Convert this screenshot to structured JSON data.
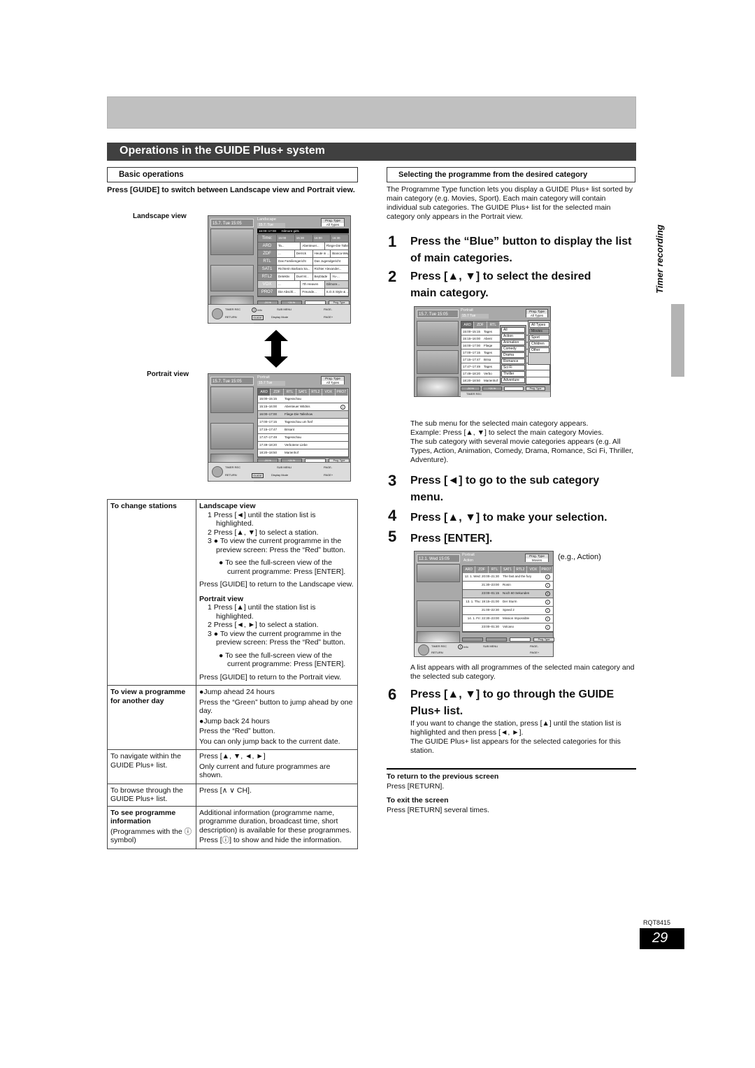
{
  "section_title": "Operations in the GUIDE Plus+ system",
  "basic_operations": {
    "heading": "Basic operations",
    "instruction": "Press [GUIDE] to switch between Landscape view and Portrait view.",
    "landscape_label": "Landscape view",
    "portrait_label": "Portrait view"
  },
  "landscape_screen": {
    "datetime": "15.7. Tue   15:05",
    "title": "Landscape",
    "subtitle": "15.7. Tue",
    "prog_type_label": "Prog. Type",
    "prog_type_value": "All Types",
    "now_playing": {
      "time": "16:00–17:00",
      "title": "Gilmore girls"
    },
    "time_header": [
      "Time:",
      "15:00",
      "15:30",
      "16:00",
      "16:30"
    ],
    "rows": [
      {
        "station": "ARD",
        "programmes": [
          "Ta...",
          "Abenteuer...",
          "Fliege-Die Talkshow"
        ]
      },
      {
        "station": "ZDF",
        "programmes": [
          "...",
          "Derrick",
          "Heute in ...",
          "Bianca-Wege..."
        ]
      },
      {
        "station": "RTL",
        "programmes": [
          "Das Familiengericht",
          "Das Jugendgericht"
        ]
      },
      {
        "station": "SAT1",
        "programmes": [
          "Richterin Barbara Sa...",
          "Richter Alexander..."
        ]
      },
      {
        "station": "RTL2",
        "programmes": [
          "Detektiv",
          "Duel M...",
          "Beyblade",
          "Yu-..."
        ]
      },
      {
        "station": "VOX",
        "programmes": [
          "...",
          "7th Heaven",
          "Gilmore..."
        ]
      },
      {
        "station": "PRO7",
        "programmes": [
          "Die Abschl...",
          "Freunde...",
          "S.O.S Style & ..."
        ]
      }
    ],
    "buttons": [
      "-24 Hr",
      "+24 Hr",
      "",
      "Prog. Type"
    ],
    "footer": {
      "timer_rec": "TIMER REC",
      "return": "RETURN",
      "info": "Info",
      "sub_menu": "SUB MENU",
      "guide": "GUIDE",
      "display_mode": "Display Mode",
      "page_minus": "PAGE-",
      "page_plus": "PAGE+"
    }
  },
  "portrait_screen": {
    "datetime": "15.7. Tue   15:05",
    "title": "Portrait",
    "subtitle": "15.7 Tue",
    "prog_type_label": "Prog. Type",
    "prog_type_value": "All Types",
    "stations": [
      "ARD",
      "ZDF",
      "RTL",
      "SAT1",
      "RTL2",
      "VOX",
      "PRO7"
    ],
    "rows": [
      {
        "time": "15:00–15:15",
        "title": "Tagesschau"
      },
      {
        "time": "15:15–16:00",
        "title": "Abenteuer Wildnis",
        "info": true
      },
      {
        "time": "16:00–17:00",
        "title": "Fliege-Die Talkshow",
        "highlight": true
      },
      {
        "time": "17:00–17:15",
        "title": "Tagesschau um fünf"
      },
      {
        "time": "17:15–17:47",
        "title": "Brisant"
      },
      {
        "time": "17:47–17:49",
        "title": "Tagesschau"
      },
      {
        "time": "17:49–18:20",
        "title": "Verbotene Liebe"
      },
      {
        "time": "18:20–18:50",
        "title": "Marienhof"
      }
    ],
    "buttons": [
      "-24 Hr",
      "+24 Hr",
      "",
      "Prog. Type"
    ],
    "footer": {
      "timer_rec": "TIMER REC",
      "return": "RETURN",
      "sub_menu": "SUB MENU",
      "guide": "GUIDE",
      "display_mode": "Display Mode",
      "page_minus": "PAGE-",
      "page_plus": "PAGE+"
    }
  },
  "ops_table": [
    {
      "label": "To change stations",
      "label_bold": true,
      "blocks": [
        {
          "heading": "Landscape view",
          "lines": [
            "1  Press [◄] until the station list is highlighted.",
            "2  Press [▲, ▼] to select a station.",
            "3  ● To view the current programme in the preview screen: Press the “Red” button.",
            "● To see the full-screen view of the current programme: Press [ENTER]."
          ],
          "after": "Press [GUIDE] to return to the Landscape view."
        },
        {
          "heading": "Portrait view",
          "lines": [
            "1  Press [▲] until the station list is highlighted.",
            "2  Press [◄, ►] to select a station.",
            "3  ● To view the current programme in the preview screen: Press the “Red” button.",
            "● To see the full-screen view of the current programme: Press [ENTER]."
          ],
          "after": "Press [GUIDE] to return to the Portrait view."
        }
      ]
    },
    {
      "label": "To view a programme for another day",
      "label_bold": true,
      "lines": [
        "●Jump ahead 24 hours",
        "Press the “Green” button to jump ahead by one day.",
        "●Jump back 24 hours",
        "Press the “Red” button.",
        "You can only jump back to the current date."
      ]
    },
    {
      "label": "To navigate within the GUIDE Plus+ list.",
      "label_bold": false,
      "lines": [
        "Press [▲, ▼, ◄, ►]",
        "Only current and future programmes are shown."
      ]
    },
    {
      "label": "To browse through the GUIDE Plus+ list.",
      "label_bold": false,
      "lines": [
        "Press [∧  ∨ CH]."
      ]
    },
    {
      "label": "To see programme information",
      "label_bold": true,
      "label_extra": "(Programmes with the ⓘ symbol)",
      "lines": [
        "Additional information (programme name, programme duration, broadcast time, short description) is available for these programmes.",
        "Press [ⓘ] to show and hide the information."
      ]
    }
  ],
  "category": {
    "heading": "Selecting the programme from the desired category",
    "intro": "The Programme Type function lets you display a GUIDE Plus+ list sorted by main category (e.g. Movies, Sport). Each main category will contain individual sub categories. The GUIDE Plus+ list for the selected main category only appears in the Portrait view.",
    "steps": [
      {
        "num": "1",
        "text": "Press the “Blue” button to display the list of main categories."
      },
      {
        "num": "2",
        "text": "Press [▲, ▼] to select the desired main category."
      },
      {
        "num": "3",
        "text": "Press [◄] to go to the sub category menu."
      },
      {
        "num": "4",
        "text": "Press [▲, ▼] to make your selection."
      },
      {
        "num": "5",
        "text": "Press [ENTER]."
      },
      {
        "num": "6",
        "text": "Press [▲, ▼] to go through the GUIDE Plus+ list."
      }
    ],
    "after_step2": "The sub menu for the selected main category appears.\nExample: Press [▲, ▼] to select the main category Movies.\nThe sub category with several movie categories appears (e.g. All Types, Action, Animation, Comedy, Drama, Romance, Sci Fi, Thriller, Adventure).",
    "example_caption": "(e.g., Action)",
    "after_step5": "A list appears with all programmes of the selected main category and the selected sub category.",
    "after_step6": "If you want to change the station, press [▲] until the station list is highlighted and then press [◄, ►].\nThe GUIDE Plus+ list appears for the selected categories for this station.",
    "return_heading": "To return to the previous screen",
    "return_text": "Press [RETURN].",
    "exit_heading": "To exit the screen",
    "exit_text": "Press [RETURN] several times."
  },
  "category_screen": {
    "datetime": "15.7. Tue   15:05",
    "title": "Portrait",
    "subtitle": "15.7 Tue",
    "prog_type_label": "Prog. Type",
    "prog_type_value": "All Types",
    "stations": [
      "ARD",
      "ZDF",
      "RTL"
    ],
    "times": [
      "15:00–15:15",
      "15:15–16:00",
      "16:00–17:00",
      "17:00–17:15",
      "17:15–17:47",
      "17:47–17:49",
      "17:49–18:20",
      "18:20–18:50"
    ],
    "titles": [
      "Tages",
      "Abent",
      "Fliege",
      "Tages",
      "Brisa",
      "Tages",
      "Verbo",
      "Marienhof"
    ],
    "sub_categories": [
      "All",
      "Action",
      "Animation",
      "Comedy",
      "Drama",
      "Romance",
      "Sci Fi",
      "Thriller",
      "Adventure"
    ],
    "main_categories": [
      "All Types",
      "Movies",
      "Sport",
      "Children",
      "Other"
    ],
    "selected_main": "Movies",
    "buttons": [
      "-24 Hr",
      "+24 Hr",
      "",
      "Prog. Type"
    ],
    "footer": {
      "timer_rec": "TIMER REC",
      "return": "RETURN"
    }
  },
  "action_screen": {
    "datetime": "12.1. Wed   15:05",
    "title": "Portrait",
    "subtitle": "Action",
    "prog_type_label": "Prog. Type",
    "prog_type_value": "Movies",
    "stations": [
      "ARD",
      "ZDF",
      "RTL",
      "SAT1",
      "RTL2",
      "VOX",
      "PRO7"
    ],
    "rows": [
      {
        "time": "12. 1. Wed: 20:00–21:30",
        "title": "The fast and the fury"
      },
      {
        "time": "21:30–23:00",
        "title": "Ronin"
      },
      {
        "time": "23:00–01:15",
        "title": "Noch 60 Sekunden",
        "highlight": true
      },
      {
        "time": "13. 1. Thu: 19:15–21:00",
        "title": "Der Sturm"
      },
      {
        "time": "21:00–22:30",
        "title": "Speed 2"
      },
      {
        "time": "14. 1. Fri: 22:30–23:00",
        "title": "Mission Impossible"
      },
      {
        "time": "23:00–01:30",
        "title": "Volcano"
      }
    ],
    "buttons": [
      "",
      "",
      "",
      "Prog. Type"
    ],
    "footer": {
      "timer_rec": "TIMER REC",
      "return": "RETURN",
      "info": "Info",
      "sub_menu": "SUB MENU",
      "page_minus": "PAGE-",
      "page_plus": "PAGE+"
    }
  },
  "side_tab": "Timer recording",
  "doc_code": "RQT8415",
  "page_number": "29"
}
